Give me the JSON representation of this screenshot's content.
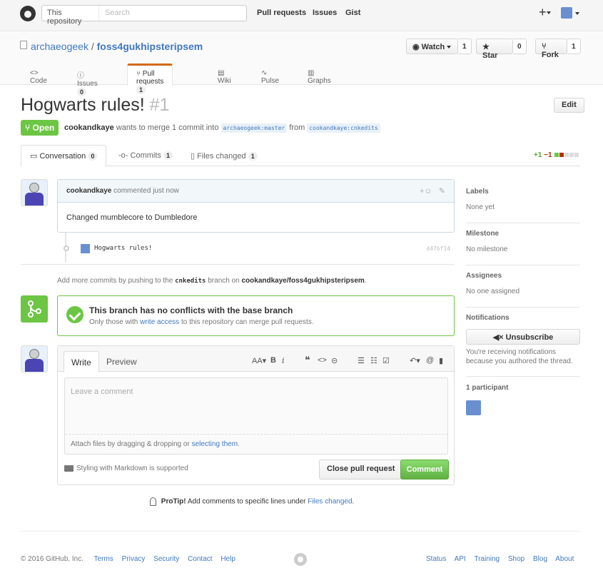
{
  "header": {
    "scope_label": "This repository",
    "search_placeholder": "Search",
    "nav": [
      "Pull requests",
      "Issues",
      "Gist"
    ],
    "plus_label": "+"
  },
  "repo": {
    "owner": "archaeogeek",
    "separator": "/",
    "name": "foss4gukhipsteripsem",
    "watch_label": "Watch",
    "watch_count": "1",
    "star_label": "Star",
    "star_count": "0",
    "fork_label": "Fork",
    "fork_count": "1",
    "tabs": {
      "code": "Code",
      "issues": "Issues",
      "issues_count": "0",
      "pulls": "Pull requests",
      "pulls_count": "1",
      "wiki": "Wiki",
      "pulse": "Pulse",
      "graphs": "Graphs"
    }
  },
  "pr": {
    "title": "Hogwarts rules!",
    "number": "#1",
    "edit_label": "Edit",
    "state": "Open",
    "author": "cookandkaye",
    "merge_text": "wants to merge 1 commit into",
    "base_ref": "archaeogeek:master",
    "from_text": "from",
    "head_ref": "cookandkaye:cnkedits",
    "tabs": {
      "conversation": "Conversation",
      "conversation_count": "0",
      "commits": "Commits",
      "commits_count": "1",
      "files": "Files changed",
      "files_count": "1"
    },
    "additions": "+1",
    "deletions": "−1"
  },
  "comment": {
    "author": "cookandkaye",
    "action": "commented",
    "time": "just now",
    "body": "Changed mumblecore to Dumbledore"
  },
  "commit": {
    "message": "Hogwarts rules!",
    "sha": "d47bf14"
  },
  "push_info": {
    "prefix": "Add more commits by pushing to the",
    "branch": "cnkedits",
    "middle": "branch on",
    "repo": "cookandkaye/foss4gukhipsteripsem",
    "suffix": "."
  },
  "merge": {
    "title": "This branch has no conflicts with the base branch",
    "sub_prefix": "Only those with",
    "sub_link": "write access",
    "sub_suffix": "to this repository can merge pull requests."
  },
  "form": {
    "write_tab": "Write",
    "preview_tab": "Preview",
    "placeholder": "Leave a comment",
    "attach_prefix": "Attach files by dragging & dropping or",
    "attach_link": "selecting them",
    "attach_suffix": ".",
    "markdown_note": "Styling with Markdown is supported",
    "close_label": "Close pull request",
    "comment_label": "Comment"
  },
  "protip": {
    "label": "ProTip!",
    "text": "Add comments to specific lines under",
    "link": "Files changed",
    "suffix": "."
  },
  "sidebar": {
    "labels_title": "Labels",
    "labels_value": "None yet",
    "milestone_title": "Milestone",
    "milestone_value": "No milestone",
    "assignees_title": "Assignees",
    "assignees_value": "No one assigned",
    "notifications_title": "Notifications",
    "unsubscribe_label": "Unsubscribe",
    "notifications_reason": "You're receiving notifications because you authored the thread.",
    "participants_title": "1 participant"
  },
  "footer": {
    "copyright": "© 2016 GitHub, Inc.",
    "left_links": [
      "Terms",
      "Privacy",
      "Security",
      "Contact",
      "Help"
    ],
    "right_links": [
      "Status",
      "API",
      "Training",
      "Shop",
      "Blog",
      "About"
    ]
  },
  "colors": {
    "accent": "#4078c0",
    "open_green": "#6cc644",
    "tab_orange": "#d26911",
    "deletion_red": "#bd2c00"
  }
}
